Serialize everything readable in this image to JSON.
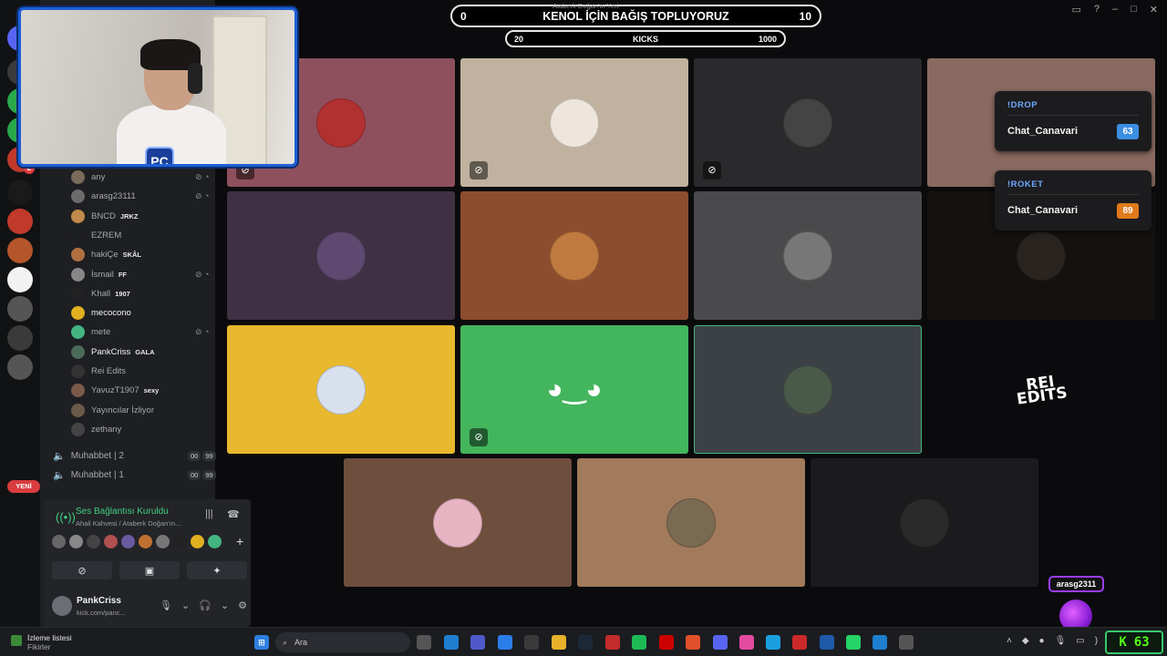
{
  "colors": {
    "accent": "#1c5fd6",
    "discord_green": "#43b581",
    "voice_connected": "#3fd07e",
    "kick_green": "#53fc18",
    "alert_purple": "#9b3cf0"
  },
  "rail": {
    "items": [
      {
        "label": "A",
        "badge": "4"
      },
      {
        "label": "",
        "badge": ""
      },
      {
        "label": "",
        "badge": ""
      },
      {
        "label": "",
        "badge": ""
      },
      {
        "label": "",
        "badge": "2"
      },
      {
        "label": "",
        "badge": ""
      },
      {
        "label": "",
        "badge": ""
      },
      {
        "label": "",
        "badge": ""
      },
      {
        "label": "",
        "badge": ""
      },
      {
        "label": "",
        "badge": ""
      },
      {
        "label": "",
        "badge": ""
      },
      {
        "label": "",
        "badge": ""
      }
    ],
    "new_label": "YENİ"
  },
  "webcam": {
    "badge": "PC"
  },
  "goal_banner": {
    "left": "0",
    "title": "KENOL İÇİN BAĞIŞ TOPLUYORUZ",
    "right": "10",
    "above": "Ataberk Doğan'ın Yeri"
  },
  "kicks_banner": {
    "left": "20",
    "title": "KICKS",
    "right": "1000"
  },
  "members": [
    {
      "name": "any",
      "tag": "",
      "tag_icon": "",
      "icons": "mic-off"
    },
    {
      "name": "arasg23111",
      "tag": "",
      "tag_icon": "",
      "icons": "mic-off,deafen"
    },
    {
      "name": "BNCD",
      "tag": "JRKZ",
      "tag_icon": "heart-icon",
      "icons": ""
    },
    {
      "name": "EZREM",
      "tag": "",
      "tag_icon": "",
      "icons": ""
    },
    {
      "name": "hakiÇe",
      "tag": "SKÂL",
      "tag_icon": "sword-icon",
      "icons": ""
    },
    {
      "name": "İsmail",
      "tag": "FF",
      "tag_icon": "heart-icon",
      "icons": "app"
    },
    {
      "name": "Khall",
      "tag": "1907",
      "tag_icon": "trophy-icon",
      "icons": ""
    },
    {
      "name": "mecocono",
      "tag": "",
      "tag_icon": "",
      "icons": ""
    },
    {
      "name": "mete",
      "tag": "",
      "tag_icon": "",
      "icons": "mic-off,deafen"
    },
    {
      "name": "PankCriss",
      "tag": "GALA",
      "tag_icon": "crown-icon",
      "icons": ""
    },
    {
      "name": "Rei Edits",
      "tag": "",
      "tag_icon": "",
      "icons": ""
    },
    {
      "name": "YavuzT1907",
      "tag": "sexy",
      "tag_icon": "heart-icon",
      "icons": ""
    },
    {
      "name": "Yayıncılar İzliyor",
      "tag": "",
      "tag_icon": "",
      "icons": ""
    },
    {
      "name": "zethany",
      "tag": "",
      "tag_icon": "",
      "icons": ""
    }
  ],
  "voice_channels": [
    {
      "name": "Muhabbet | 2",
      "count_a": "00",
      "count_b": "99"
    },
    {
      "name": "Muhabbet | 1",
      "count_a": "00",
      "count_b": "99"
    }
  ],
  "voice_status": {
    "title": "Ses Bağlantısı Kuruldu",
    "subtitle": "Ahali Kahvesi / Ataberk Doğan'ın..."
  },
  "user": {
    "name": "PankCriss",
    "status": "kick.com/panc..."
  },
  "tiles": [
    {
      "color": "#8e505c",
      "avatar": "#b13030",
      "muted": true,
      "kind": "avatar",
      "label": ""
    },
    {
      "color": "#c0b29e",
      "avatar": "#eee6dc",
      "muted": true,
      "kind": "avatar",
      "label": ""
    },
    {
      "color": "#2a2a2c",
      "avatar": "#444",
      "muted": true,
      "kind": "avatar",
      "label": ""
    },
    {
      "color": "#8a6a60",
      "avatar": "",
      "muted": false,
      "kind": "empty",
      "label": ""
    },
    {
      "color": "#3f3044",
      "avatar": "#5e4a70",
      "muted": false,
      "kind": "avatar",
      "label": ""
    },
    {
      "color": "#8c4c2e",
      "avatar": "#c07a40",
      "muted": false,
      "kind": "avatar",
      "label": ""
    },
    {
      "color": "#4a4a4c",
      "avatar": "#777",
      "muted": false,
      "kind": "avatar",
      "label": ""
    },
    {
      "color": "#141210",
      "avatar": "#2a2420",
      "muted": false,
      "kind": "avatar",
      "label": ""
    },
    {
      "color": "#e8b82e",
      "avatar": "#d8e0ee",
      "muted": false,
      "kind": "avatar",
      "label": ""
    },
    {
      "color": "#43b55c",
      "avatar": "",
      "muted": true,
      "kind": "discord",
      "label": ""
    },
    {
      "color": "#3c4146",
      "avatar": "#4a5a4a",
      "muted": false,
      "kind": "avatar",
      "label": ""
    },
    {
      "color": "#0b0b0d",
      "avatar": "",
      "muted": false,
      "kind": "rei",
      "label": "REI\nEDITS"
    },
    {
      "color": "#6e4e3c",
      "avatar": "#e8b4c4",
      "muted": false,
      "kind": "avatar",
      "label": ""
    },
    {
      "color": "#a27a5c",
      "avatar": "#7a6a52",
      "muted": false,
      "kind": "avatar",
      "label": ""
    },
    {
      "color": "#1b1b1d",
      "avatar": "#2a2a2a",
      "muted": false,
      "kind": "avatar",
      "label": ""
    }
  ],
  "drops": [
    {
      "command": "!DROP",
      "user": "Chat_Canavari",
      "value": "63",
      "value_color": "#3c8ee0"
    },
    {
      "command": "!ROKET",
      "user": "Chat_Canavari",
      "value": "89",
      "value_color": "#e07a1c"
    }
  ],
  "alert": {
    "name": "arasg2311"
  },
  "taskbar": {
    "watchlist_title": "İzleme listesi",
    "watchlist_sub": "Fikirler",
    "search_placeholder": "Ara",
    "kick_count": "63"
  }
}
